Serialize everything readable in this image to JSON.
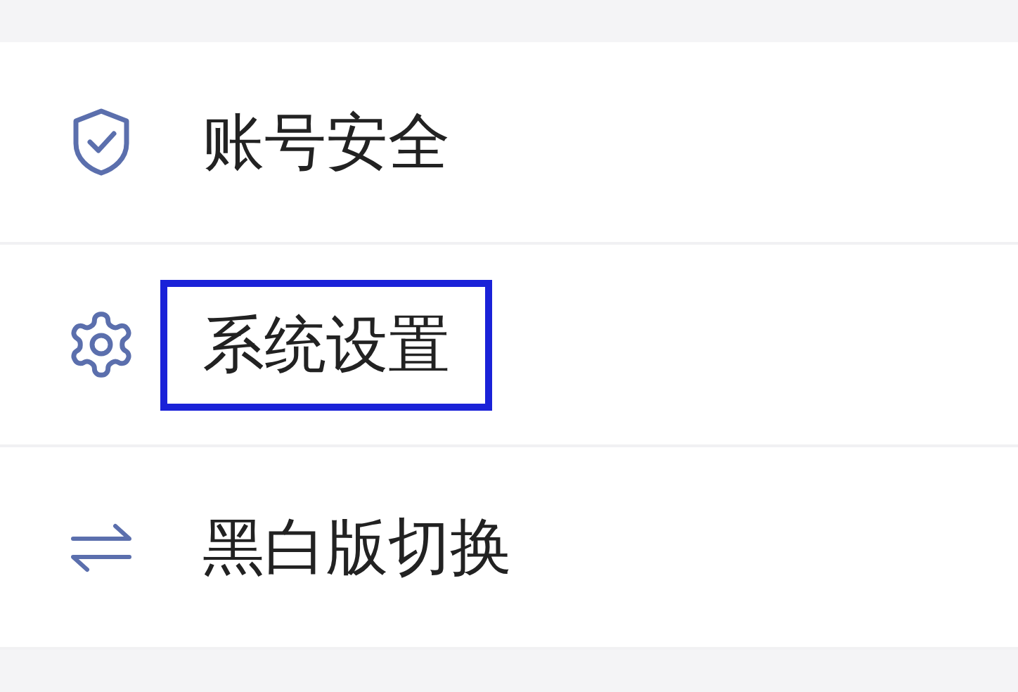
{
  "menu": {
    "items": [
      {
        "label": "账号安全",
        "kind": "shield",
        "highlighted": false
      },
      {
        "label": "系统设置",
        "kind": "gear",
        "highlighted": true
      },
      {
        "label": "黑白版切换",
        "kind": "swap",
        "highlighted": false
      }
    ]
  }
}
